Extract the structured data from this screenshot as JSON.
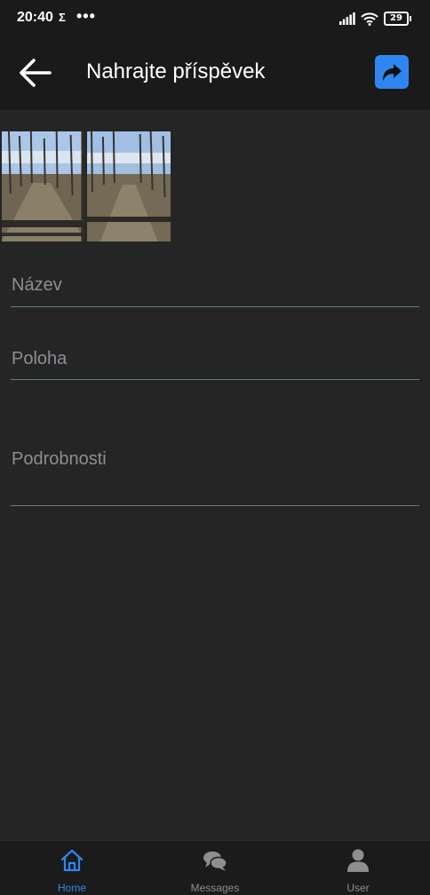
{
  "status_bar": {
    "time": "20:40",
    "sigma": "Σ",
    "dots": "•••",
    "battery": "29"
  },
  "header": {
    "title": "Nahrajte příspěvek",
    "back_icon": "arrow-left-icon",
    "share_icon": "share-arrow-icon",
    "accent_color": "#2f86f0"
  },
  "form": {
    "fields": [
      {
        "label": "Název"
      },
      {
        "label": "Poloha"
      },
      {
        "label": "Podrobnosti"
      }
    ]
  },
  "bottom_nav": {
    "items": [
      {
        "label": "Home",
        "icon": "home-icon",
        "active": true
      },
      {
        "label": "Messages",
        "icon": "chat-bubbles-icon",
        "active": false
      },
      {
        "label": "User",
        "icon": "user-icon",
        "active": false
      }
    ]
  }
}
